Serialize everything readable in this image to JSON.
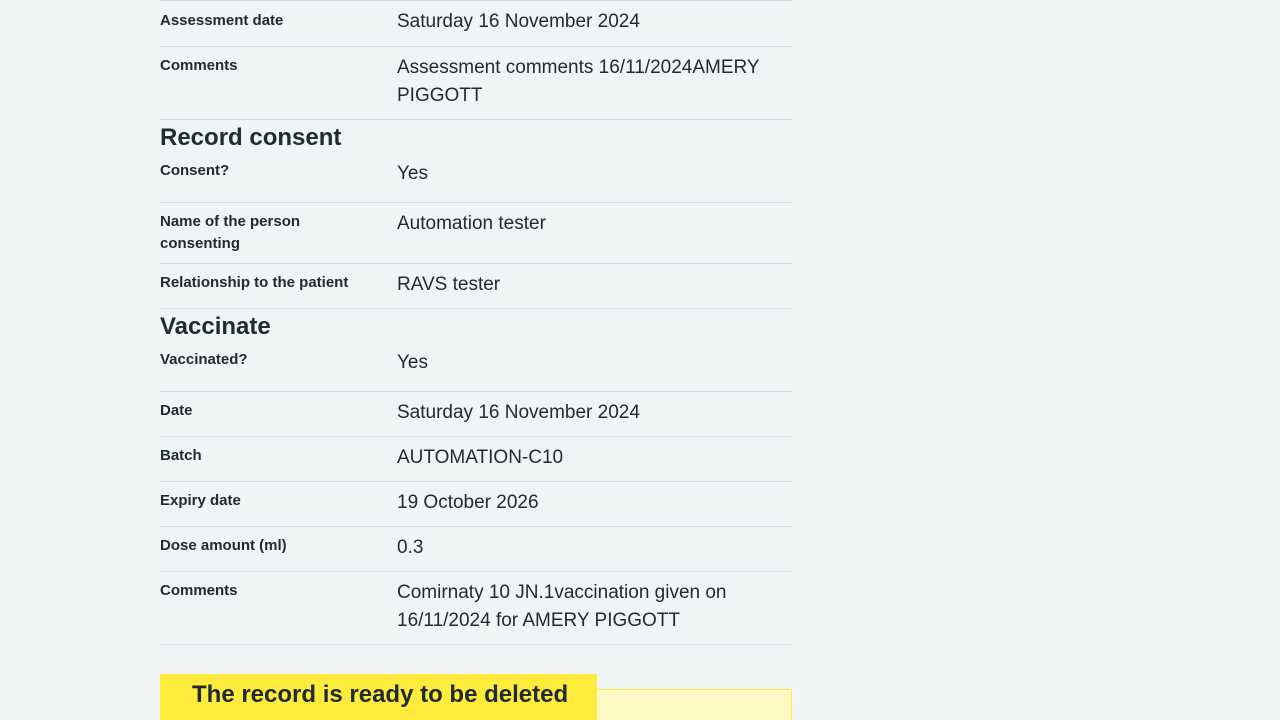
{
  "assessment": {
    "rows": [
      {
        "key": "Assessment date",
        "value": "Saturday 16 November 2024"
      },
      {
        "key": "Comments",
        "value": "Assessment comments 16/11/2024AMERY PIGGOTT"
      }
    ]
  },
  "consent": {
    "heading": "Record consent",
    "rows": [
      {
        "key": "Consent?",
        "value": "Yes"
      },
      {
        "key": "Name of the person consenting",
        "value": "Automation tester"
      },
      {
        "key": "Relationship to the patient",
        "value": "RAVS tester"
      }
    ]
  },
  "vaccinate": {
    "heading": "Vaccinate",
    "rows": [
      {
        "key": "Vaccinated?",
        "value": "Yes"
      },
      {
        "key": "Date",
        "value": "Saturday 16 November 2024"
      },
      {
        "key": "Batch",
        "value": "AUTOMATION-C10"
      },
      {
        "key": "Expiry date",
        "value": "19 October 2026"
      },
      {
        "key": "Dose amount (ml)",
        "value": "0.3"
      },
      {
        "key": "Comments",
        "value": "Comirnaty 10 JN.1vaccination given on 16/11/2024 for AMERY PIGGOTT"
      }
    ]
  },
  "warning": {
    "label": "The record is ready to be deleted"
  }
}
